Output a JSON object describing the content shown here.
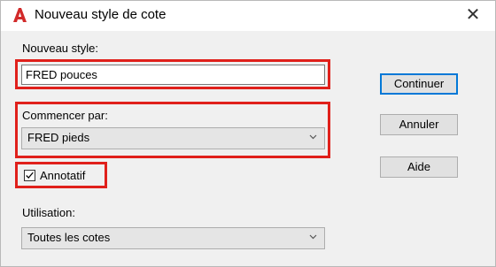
{
  "window": {
    "title": "Nouveau style de cote",
    "app_icon": "autocad-a-icon",
    "close_glyph": "✕"
  },
  "form": {
    "new_style_label": "Nouveau style:",
    "new_style_value": "FRED pouces",
    "start_with_label": "Commencer par:",
    "start_with_value": "FRED pieds",
    "annotative_label": "Annotatif",
    "annotative_checked": true,
    "usage_label": "Utilisation:",
    "usage_value": "Toutes les cotes"
  },
  "buttons": {
    "continue": "Continuer",
    "cancel": "Annuler",
    "help": "Aide"
  },
  "colors": {
    "highlight_red": "#e0201b",
    "focus_blue": "#0078d7",
    "app_icon_red": "#d22a2a"
  }
}
